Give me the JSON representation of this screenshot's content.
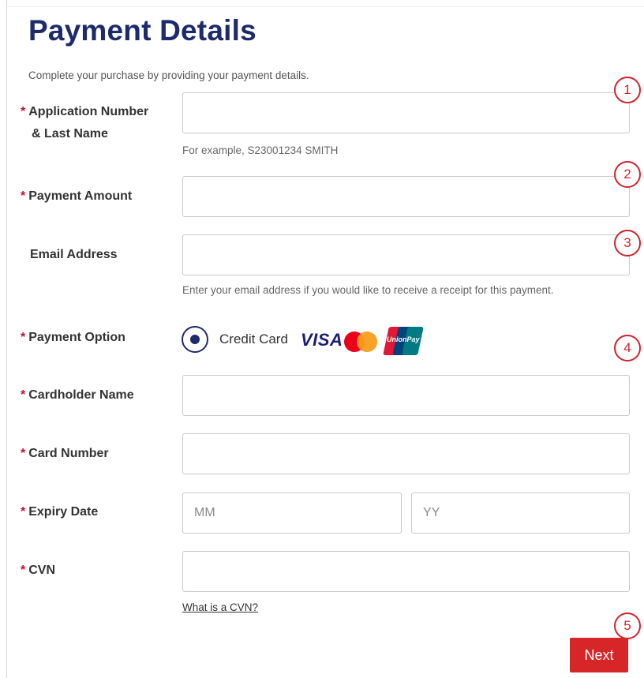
{
  "page": {
    "title": "Payment Details",
    "subtitle": "Complete your purchase by providing your payment details."
  },
  "fields": {
    "application": {
      "label_line1": "Application Number",
      "label_line2": "& Last Name",
      "value": "",
      "help": "For example, S23001234 SMITH",
      "required_mark": "*"
    },
    "amount": {
      "label": "Payment Amount",
      "value": "",
      "required_mark": "*"
    },
    "email": {
      "label": "Email Address",
      "value": "",
      "help": "Enter your email address if you would like to receive a receipt for this payment."
    },
    "payment_option": {
      "label": "Payment Option",
      "required_mark": "*",
      "selected_option": "Credit Card",
      "brands": [
        "VISA",
        "Mastercard",
        "UnionPay"
      ],
      "visa_text": "VISA",
      "unionpay_text": "UnionPay"
    },
    "cardholder": {
      "label": "Cardholder Name",
      "value": "",
      "required_mark": "*"
    },
    "card_number": {
      "label": "Card Number",
      "value": "",
      "required_mark": "*"
    },
    "expiry": {
      "label": "Expiry Date",
      "required_mark": "*",
      "month_placeholder": "MM",
      "year_placeholder": "YY"
    },
    "cvn": {
      "label": "CVN",
      "value": "",
      "required_mark": "*",
      "help_link": "What is a CVN?"
    }
  },
  "actions": {
    "next_label": "Next"
  },
  "annotations": [
    "1",
    "2",
    "3",
    "4",
    "5"
  ],
  "colors": {
    "title": "#1d2a6b",
    "required": "#c8102e",
    "next_button": "#d62628",
    "annotation": "#d0242c",
    "visa": "#1a1f71"
  },
  "icons": [
    "radio-selected-icon",
    "visa-logo-icon",
    "mastercard-logo-icon",
    "unionpay-logo-icon"
  ]
}
